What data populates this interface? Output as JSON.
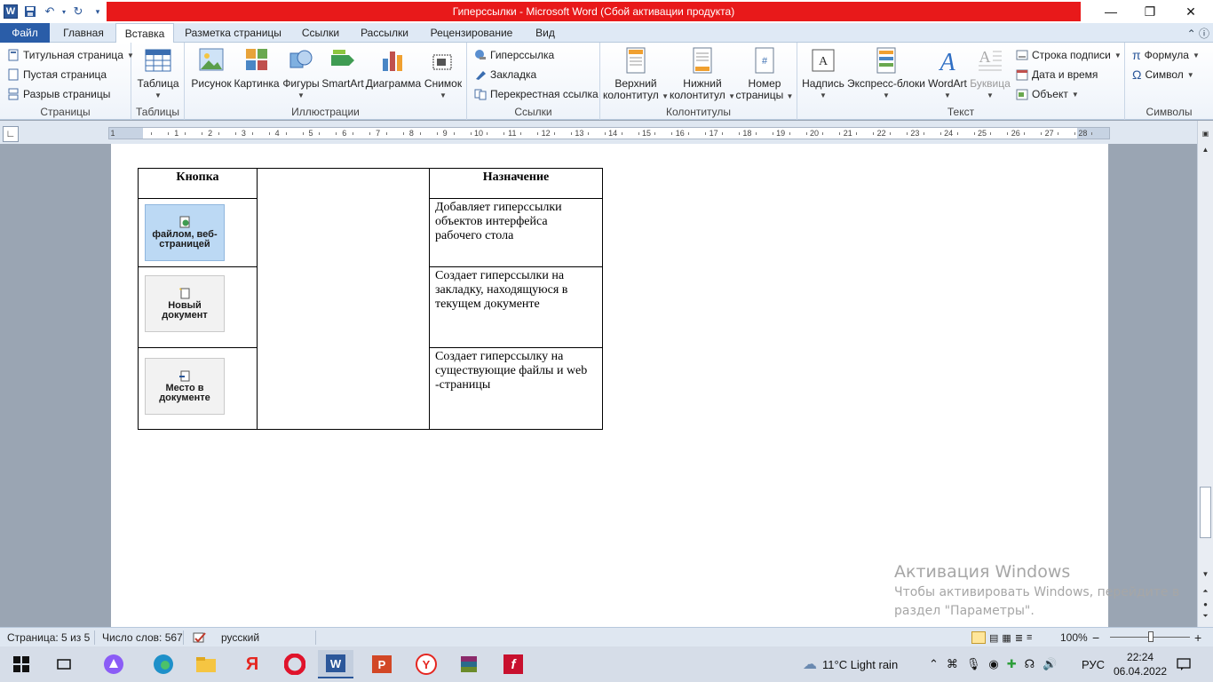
{
  "window": {
    "title": "Гиперссылки  -  Microsoft Word (Сбой активации продукта)",
    "minimize": "—",
    "restore": "❐",
    "close": "✕"
  },
  "tabs": [
    {
      "label": "Файл"
    },
    {
      "label": "Главная"
    },
    {
      "label": "Вставка"
    },
    {
      "label": "Разметка страницы"
    },
    {
      "label": "Ссылки"
    },
    {
      "label": "Рассылки"
    },
    {
      "label": "Рецензирование"
    },
    {
      "label": "Вид"
    }
  ],
  "ribbon": {
    "pages": {
      "title_page": "Титульная страница",
      "blank_page": "Пустая страница",
      "page_break": "Разрыв страницы",
      "label": "Страницы"
    },
    "tables": {
      "table": "Таблица",
      "label": "Таблицы"
    },
    "illustrations": {
      "picture": "Рисунок",
      "clipart": "Картинка",
      "shapes": "Фигуры",
      "smartart": "SmartArt",
      "chart": "Диаграмма",
      "screenshot": "Снимок",
      "label": "Иллюстрации"
    },
    "links": {
      "hyperlink": "Гиперссылка",
      "bookmark": "Закладка",
      "crossref": "Перекрестная ссылка",
      "label": "Ссылки"
    },
    "headers": {
      "header_l1": "Верхний",
      "header_l2": "колонтитул",
      "footer_l1": "Нижний",
      "footer_l2": "колонтитул",
      "pagenum_l1": "Номер",
      "pagenum_l2": "страницы",
      "label": "Колонтитулы"
    },
    "text": {
      "textbox": "Надпись",
      "quickparts": "Экспресс-блоки",
      "wordart": "WordArt",
      "dropcap": "Буквица",
      "signature": "Строка подписи",
      "datetime": "Дата и время",
      "object": "Объект",
      "label": "Текст"
    },
    "symbols": {
      "equation": "Формула",
      "symbol": "Символ",
      "label": "Символы"
    }
  },
  "ruler": {
    "numbers": [
      "1",
      "1",
      "2",
      "3",
      "4",
      "5",
      "6",
      "7",
      "8",
      "9",
      "10",
      "11",
      "12",
      "13",
      "14",
      "15",
      "16",
      "17",
      "18",
      "19",
      "20",
      "21",
      "22",
      "23",
      "24",
      "25",
      "26",
      "27",
      "28"
    ]
  },
  "table": {
    "header": {
      "col1": "Кнопка",
      "col2": "",
      "col3": "Назначение"
    },
    "rows": [
      {
        "button_label_1": "файлом, веб-",
        "button_label_2": "страницей",
        "description": "Добавляет гиперссылки объектов интерфейса рабочего стола"
      },
      {
        "button_label_1": "Новый",
        "button_label_2": "документ",
        "description": "Создает гиперссылки на закладку, находящуюся в текущем документе"
      },
      {
        "button_label_1": "Место в",
        "button_label_2": "документе",
        "description": "Создает гиперссылку на существующие файлы и web -страницы"
      }
    ]
  },
  "watermark": {
    "title": "Активация Windows",
    "text": "Чтобы активировать Windows, перейдите в раздел \"Параметры\"."
  },
  "status": {
    "page": "Страница: 5 из 5",
    "words": "Число слов: 567",
    "language": "русский",
    "zoom": "100%",
    "zoom_minus": "−",
    "zoom_plus": "+"
  },
  "taskbar": {
    "weather": "11°C  Light rain",
    "language": "РУС",
    "time": "22:24",
    "date": "06.04.2022"
  },
  "colors": {
    "title_accent": "#e8191a",
    "file_tab": "#2a5da8",
    "ribbon_bg": "#dfe9f5"
  }
}
